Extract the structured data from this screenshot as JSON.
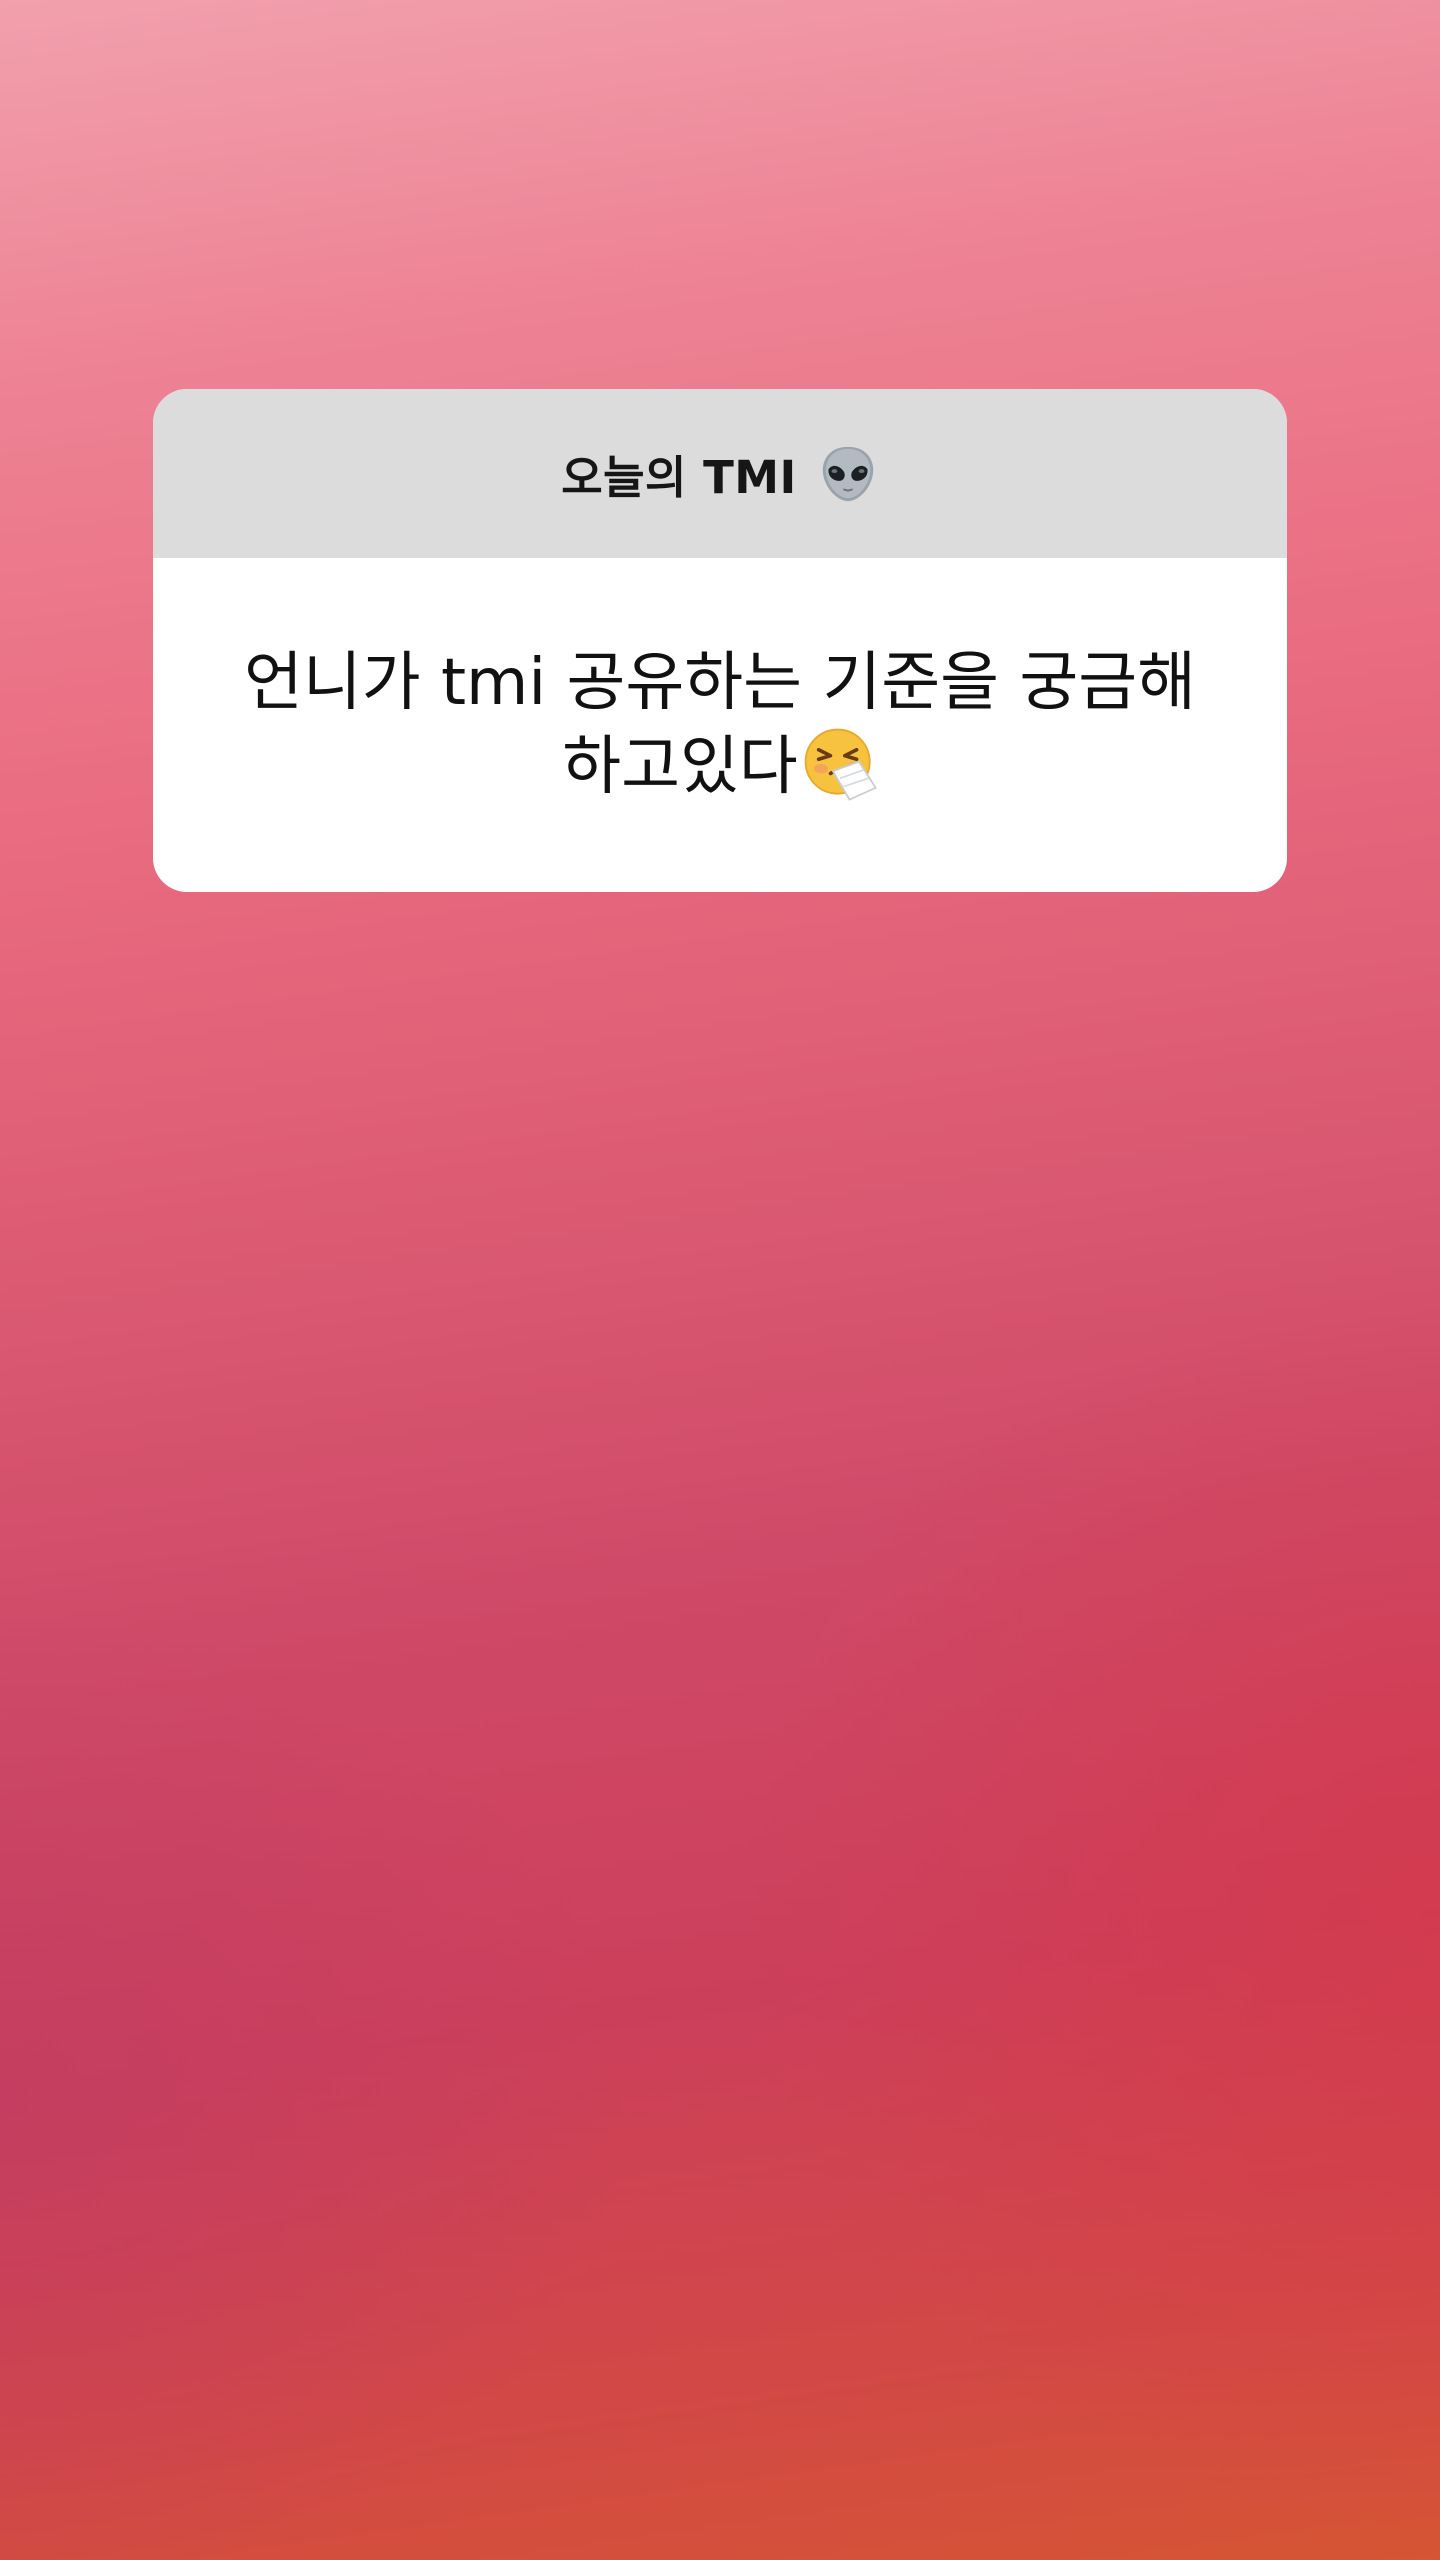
{
  "question_sticker": {
    "title": "오늘의 TMI",
    "title_icon": "alien-icon"
  },
  "answer": {
    "text": "언니가 tmi 공유하는 기준을 궁금해하고있다",
    "trailing_icon": "sneezing-face-icon"
  },
  "colors": {
    "header_background": "#dcdcdc",
    "body_background": "#ffffff",
    "background_top": "#f2a0ad",
    "background_bottom": "#d65534"
  }
}
